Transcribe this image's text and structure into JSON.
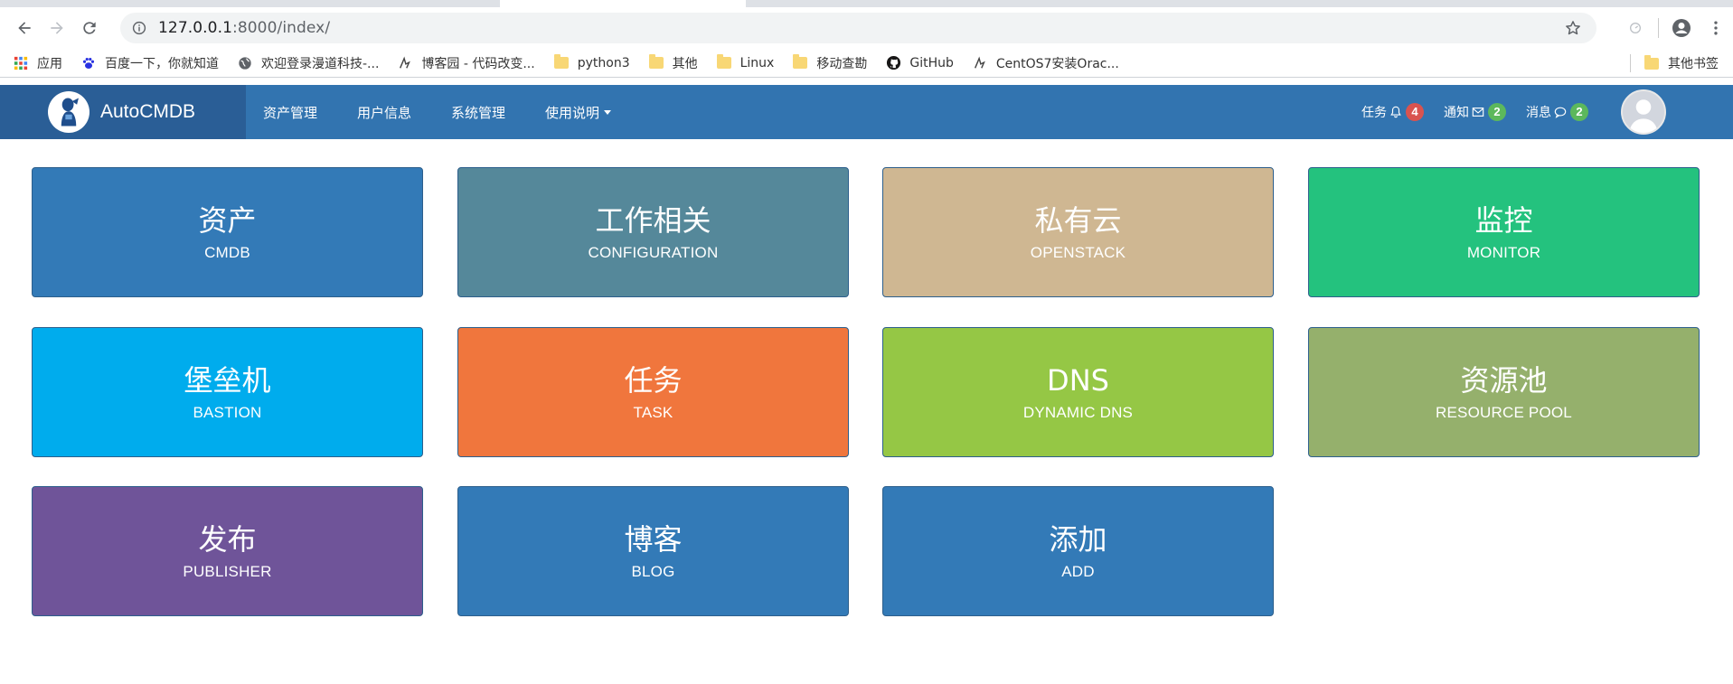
{
  "browser": {
    "url_host": "127.0.0.1",
    "url_path": ":8000/index/",
    "bookmarks": [
      {
        "label": "应用",
        "icon": "apps-grid-icon"
      },
      {
        "label": "百度一下，你就知道",
        "icon": "baidu-paw-icon"
      },
      {
        "label": "欢迎登录漫道科技-...",
        "icon": "globe-icon"
      },
      {
        "label": "博客园 - 代码改变...",
        "icon": "cnblogs-icon"
      },
      {
        "label": "python3",
        "icon": "folder-icon"
      },
      {
        "label": "其他",
        "icon": "folder-icon"
      },
      {
        "label": "Linux",
        "icon": "folder-icon"
      },
      {
        "label": "移动查勘",
        "icon": "folder-icon"
      },
      {
        "label": "GitHub",
        "icon": "github-icon"
      },
      {
        "label": "CentOS7安装Orac...",
        "icon": "cnblogs-icon"
      }
    ],
    "other_bookmarks": "其他书签"
  },
  "navbar": {
    "brand": "AutoCMDB",
    "menu": [
      "资产管理",
      "用户信息",
      "系统管理",
      "使用说明"
    ],
    "tasks_label": "任务",
    "tasks_count": "4",
    "notices_label": "通知",
    "notices_count": "2",
    "messages_label": "消息",
    "messages_count": "2"
  },
  "tiles": [
    {
      "cn": "资产",
      "en": "CMDB",
      "color": "#337ab7"
    },
    {
      "cn": "工作相关",
      "en": "CONFIGURATION",
      "color": "#55889a"
    },
    {
      "cn": "私有云",
      "en": "OPENSTACK",
      "color": "#cfb792"
    },
    {
      "cn": "监控",
      "en": "MONITOR",
      "color": "#24c27e"
    },
    {
      "cn": "堡垒机",
      "en": "BASTION",
      "color": "#00aced"
    },
    {
      "cn": "任务",
      "en": "TASK",
      "color": "#f0763d"
    },
    {
      "cn": "DNS",
      "en": "DYNAMIC DNS",
      "color": "#95c745"
    },
    {
      "cn": "资源池",
      "en": "RESOURCE POOL",
      "color": "#95b06c"
    },
    {
      "cn": "发布",
      "en": "PUBLISHER",
      "color": "#6f5499"
    },
    {
      "cn": "博客",
      "en": "BLOG",
      "color": "#337ab7"
    },
    {
      "cn": "添加",
      "en": "ADD",
      "color": "#337ab7"
    }
  ]
}
